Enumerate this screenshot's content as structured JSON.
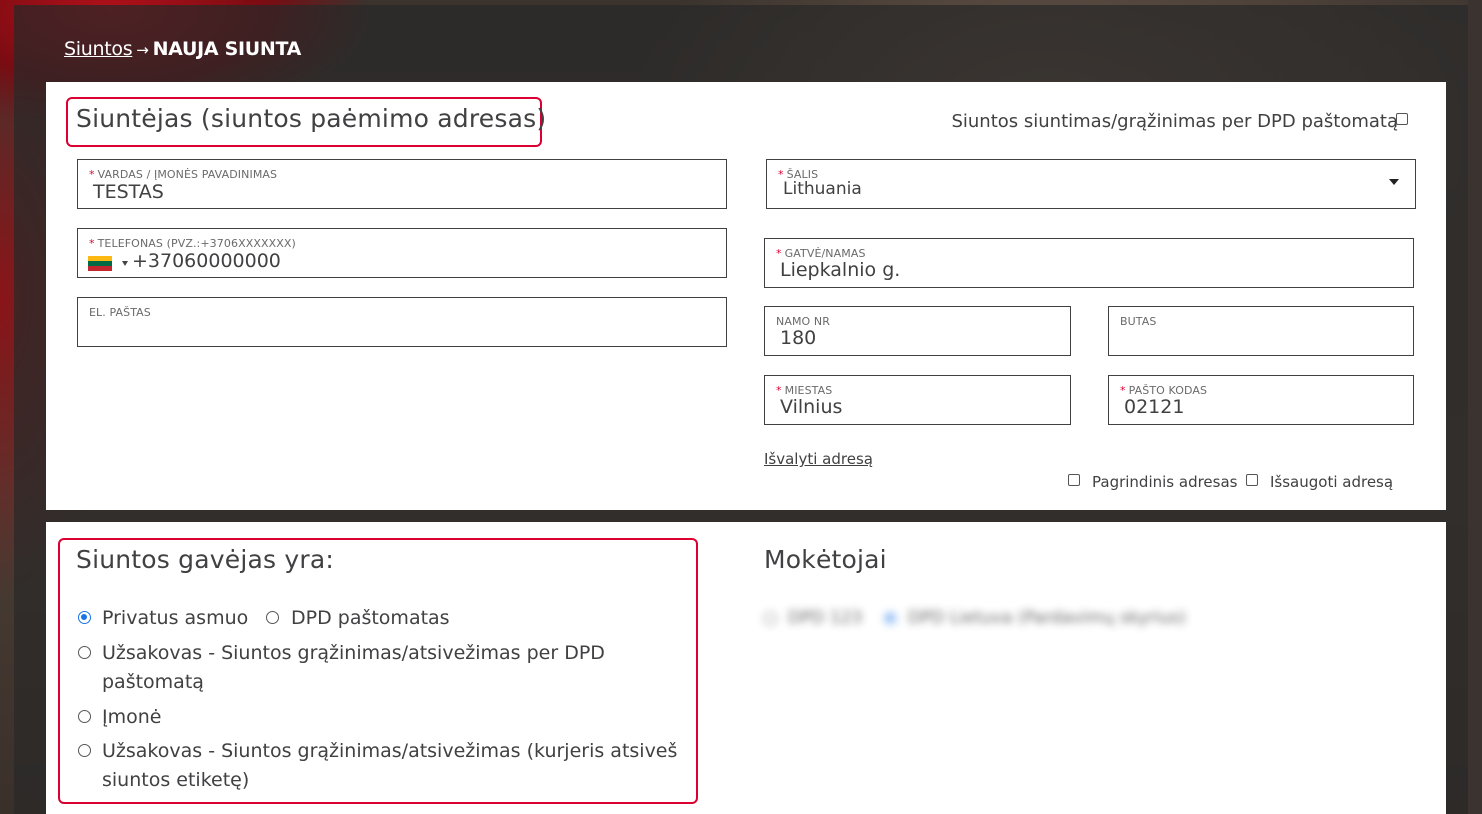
{
  "breadcrumb": {
    "parent": "Siuntos",
    "arrow": "→",
    "current": "NAUJA SIUNTA"
  },
  "sender": {
    "title": "Siuntėjas (siuntos paėmimo adresas)",
    "parcel_locker_toggle_label": "Siuntos siuntimas/grąžinimas per DPD paštomatą",
    "fields": {
      "name": {
        "label": "VARDAS / ĮMONĖS PAVADINIMAS",
        "required": "*",
        "value": "TESTAS"
      },
      "phone": {
        "label": "TELEFONAS (PVZ.:+3706XXXXXXX)",
        "required": "*",
        "value": "+37060000000"
      },
      "email": {
        "label": "EL. PAŠTAS",
        "value": ""
      },
      "country": {
        "label": "ŠALIS",
        "required": "*",
        "value": "Lithuania"
      },
      "street": {
        "label": "GATVĖ/NAMAS",
        "required": "*",
        "value": "Liepkalnio g."
      },
      "house_no": {
        "label": "NAMO NR",
        "value": "180"
      },
      "apartment": {
        "label": "BUTAS",
        "value": ""
      },
      "city": {
        "label": "MIESTAS",
        "required": "*",
        "value": "Vilnius"
      },
      "postcode": {
        "label": "PAŠTO KODAS",
        "required": "*",
        "value": "02121"
      }
    },
    "clear_address_link": "Išvalyti adresą",
    "default_address_label": "Pagrindinis adresas",
    "save_address_label": "Išsaugoti adresą"
  },
  "recipient": {
    "title": "Siuntos gavėjas yra:",
    "options": [
      {
        "label": "Privatus asmuo",
        "checked": true
      },
      {
        "label": "DPD paštomatas",
        "checked": false
      },
      {
        "label": "Užsakovas - Siuntos grąžinimas/atsivežimas per DPD",
        "label_line2": "paštomatą",
        "checked": false
      },
      {
        "label": "Įmonė",
        "checked": false
      },
      {
        "label": "Užsakovas - Siuntos grąžinimas/atsivežimas (kurjeris atsiveš",
        "label_line2": "siuntos etiketę)",
        "checked": false
      }
    ]
  },
  "payers": {
    "title": "Mokėtojai",
    "options": [
      {
        "label": "DPD 123",
        "checked": false
      },
      {
        "label": "DPD Lietuva (Pardavimų skyrius)",
        "checked": true
      }
    ]
  },
  "colors": {
    "accent_red": "#dc0032",
    "radio_blue": "#1a73e8",
    "text": "#414042"
  }
}
